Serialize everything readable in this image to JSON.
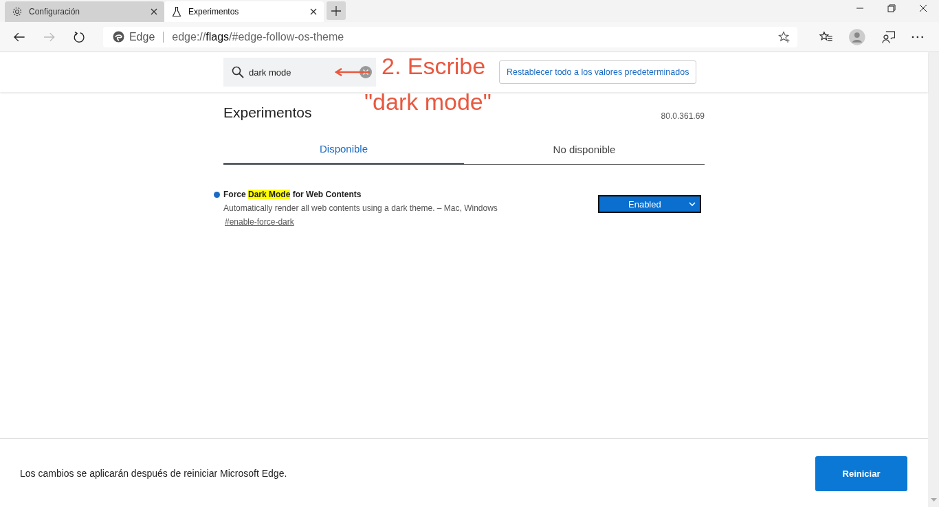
{
  "tabs": [
    {
      "label": "Configuración",
      "selected": false
    },
    {
      "label": "Experimentos",
      "selected": true
    }
  ],
  "address": {
    "site_label": "Edge",
    "url_prefix": "edge://",
    "url_host": "flags",
    "url_rest": "/#edge-follow-os-theme"
  },
  "search": {
    "value": "dark mode"
  },
  "reset_button": "Restablecer todo a los valores predeterminados",
  "title": "Experimentos",
  "version": "80.0.361.69",
  "view_tabs": [
    {
      "label": "Disponible",
      "selected": true
    },
    {
      "label": "No disponible",
      "selected": false
    }
  ],
  "flags": [
    {
      "modified": true,
      "title_parts": [
        {
          "text": "Force ",
          "highlighted": false
        },
        {
          "text": "Dark Mode",
          "highlighted": true
        },
        {
          "text": " for Web Contents",
          "highlighted": false
        }
      ],
      "description": "Automatically render all web contents using a dark theme. – Mac, Windows",
      "link": "#enable-force-dark",
      "value": "Enabled"
    }
  ],
  "footer": {
    "message": "Los cambios se aplicarán después de reiniciar Microsoft Edge.",
    "button": "Reiniciar"
  },
  "annotation": {
    "lines": [
      "2. Escribe",
      "\"dark mode\""
    ]
  }
}
